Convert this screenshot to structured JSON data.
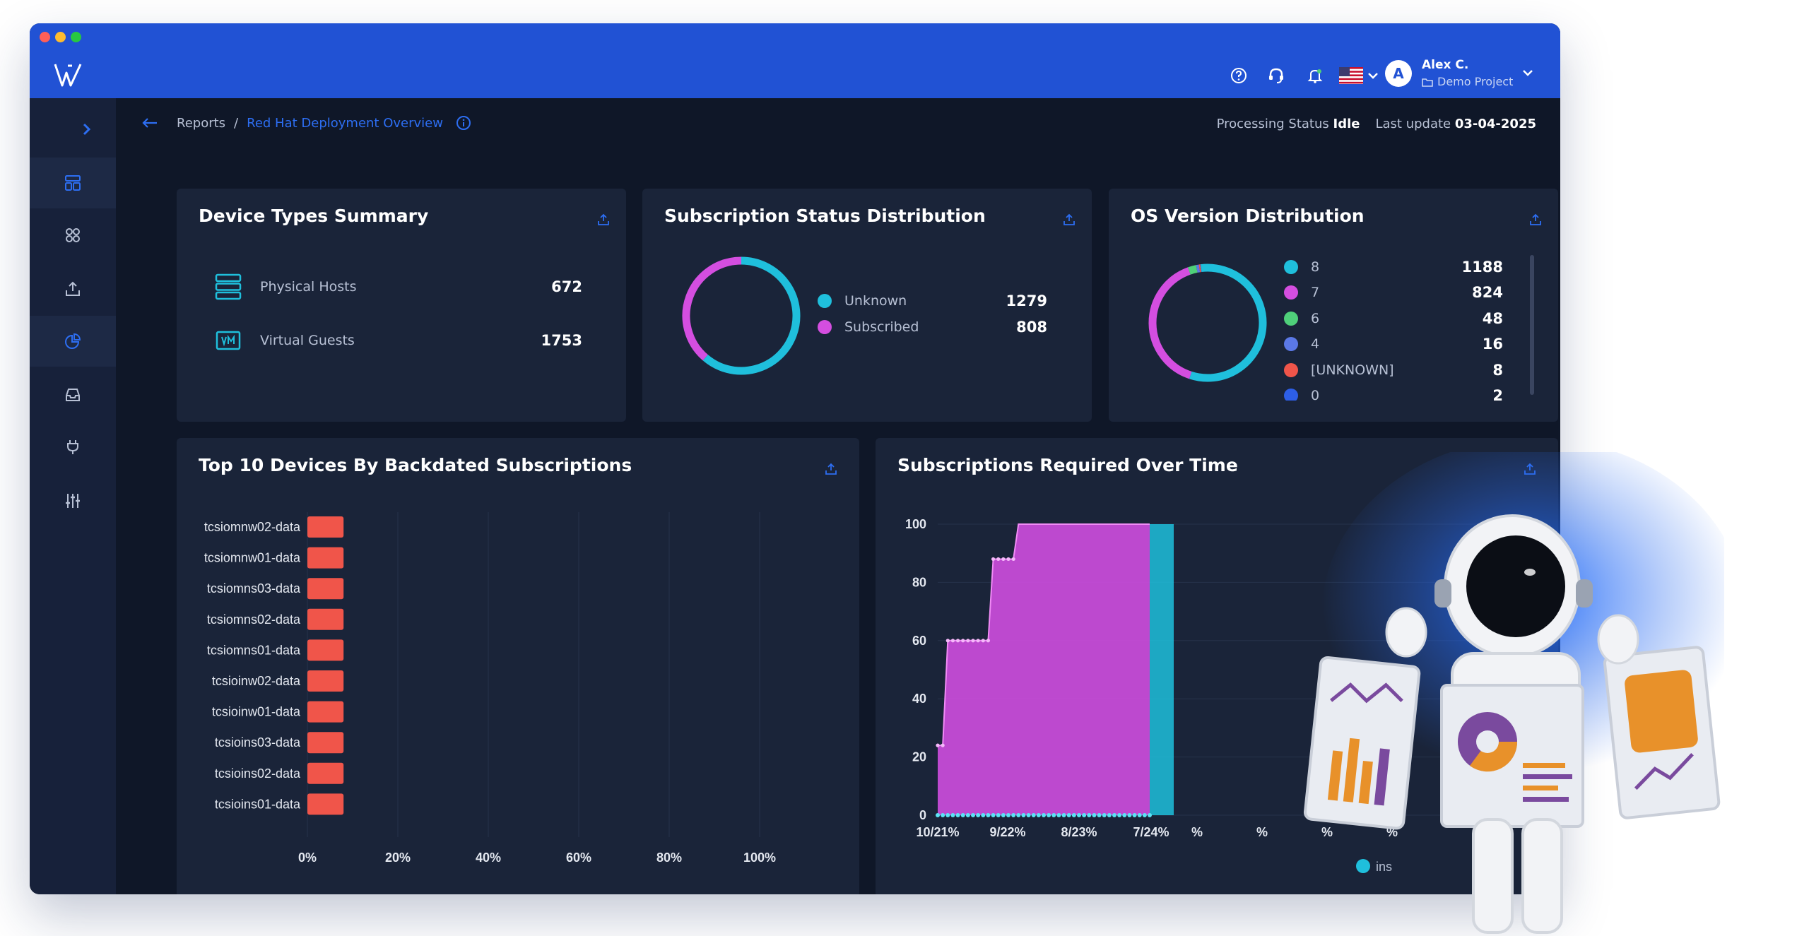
{
  "window": {
    "colors": {
      "header": "#2152d4",
      "sidebar": "#17213a",
      "background": "#0f1728",
      "card": "#1a2439",
      "accent": "#2d6ef2"
    }
  },
  "header": {
    "icons": [
      "help-icon",
      "support-icon",
      "bell-icon",
      "us-flag-icon",
      "chevron-down-icon"
    ],
    "user": {
      "initial": "A",
      "name": "Alex C.",
      "project": "Demo Project"
    }
  },
  "sidebar": {
    "toggle_icon": "chevron-right-icon",
    "items": [
      {
        "icon": "dashboard-icon",
        "active": true
      },
      {
        "icon": "grid-icon",
        "active": false
      },
      {
        "icon": "upload-icon",
        "active": false
      },
      {
        "icon": "pie-chart-icon",
        "active": true
      },
      {
        "icon": "inbox-icon",
        "active": false
      },
      {
        "icon": "plug-icon",
        "active": false
      },
      {
        "icon": "sliders-icon",
        "active": false
      }
    ]
  },
  "breadcrumb": {
    "back_icon": "arrow-left-icon",
    "root": "Reports",
    "separator": "/",
    "current": "Red Hat Deployment Overview"
  },
  "status": {
    "processing_label": "Processing Status",
    "processing_value": "Idle",
    "update_label": "Last update",
    "update_value": "03-04-2025"
  },
  "cards": {
    "device_types": {
      "title": "Device Types Summary",
      "rows": [
        {
          "icon": "server-icon",
          "label": "Physical Hosts",
          "value": "672"
        },
        {
          "icon": "vm-icon",
          "label": "Virtual Guests",
          "value": "1753"
        }
      ]
    },
    "subscription_status": {
      "title": "Subscription Status Distribution",
      "legend": [
        {
          "label": "Unknown",
          "value": "1279",
          "color": "#1fbfdc"
        },
        {
          "label": "Subscribed",
          "value": "808",
          "color": "#d44ee0"
        }
      ]
    },
    "os_version": {
      "title": "OS Version Distribution",
      "legend": [
        {
          "label": "8",
          "value": "1188",
          "color": "#1fbfdc"
        },
        {
          "label": "7",
          "value": "824",
          "color": "#d44ee0"
        },
        {
          "label": "6",
          "value": "48",
          "color": "#4fd07a"
        },
        {
          "label": "4",
          "value": "16",
          "color": "#5b78e6"
        },
        {
          "label": "[UNKNOWN]",
          "value": "8",
          "color": "#f0554a"
        },
        {
          "label": "0",
          "value": "2",
          "color": "#2d5ee6"
        }
      ]
    },
    "top_devices": {
      "title": "Top 10 Devices By Backdated Subscriptions"
    },
    "subscriptions_time": {
      "title": "Subscriptions Required Over Time"
    }
  },
  "chart_data": [
    {
      "type": "pie",
      "title": "Subscription Status Distribution",
      "categories": [
        "Unknown",
        "Subscribed"
      ],
      "values": [
        1279,
        808
      ]
    },
    {
      "type": "pie",
      "title": "OS Version Distribution",
      "categories": [
        "8",
        "7",
        "6",
        "4",
        "[UNKNOWN]",
        "0"
      ],
      "values": [
        1188,
        824,
        48,
        16,
        8,
        2
      ]
    },
    {
      "type": "bar",
      "title": "Top 10 Devices By Backdated Subscriptions",
      "orientation": "horizontal",
      "categories": [
        "tcsiomnw02-data",
        "tcsiomnw01-data",
        "tcsiomns03-data",
        "tcsiomns02-data",
        "tcsiomns01-data",
        "tcsioinw02-data",
        "tcsioinw01-data",
        "tcsioins03-data",
        "tcsioins02-data",
        "tcsioins01-data"
      ],
      "values": [
        8,
        8,
        8,
        8,
        8,
        8,
        8,
        8,
        8,
        8
      ],
      "xticks": [
        "0%",
        "20%",
        "40%",
        "60%",
        "80%",
        "100%"
      ],
      "xlim": [
        0,
        100
      ],
      "color": "#f0554a"
    },
    {
      "type": "area",
      "title": "Subscriptions Required Over Time",
      "x": [
        "10/21%",
        "9/22%",
        "8/23%",
        "7/24%"
      ],
      "extra_ticks": [
        "%",
        "%",
        "%",
        "%"
      ],
      "yticks": [
        0,
        20,
        40,
        60,
        80,
        100
      ],
      "ylim": [
        0,
        100
      ],
      "series": [
        {
          "color": "#cf4ee0",
          "values": [
            24,
            24,
            60,
            60,
            60,
            60,
            60,
            60,
            60,
            60,
            60,
            88,
            88,
            88,
            88,
            88,
            100,
            100,
            100,
            100,
            100,
            100,
            100,
            100,
            100,
            100,
            100,
            100,
            100,
            100,
            100,
            100,
            100,
            100,
            100,
            100,
            100,
            100,
            100,
            100,
            100,
            100,
            100
          ]
        },
        {
          "color": "#1fbfdc",
          "values": [
            0,
            0,
            0,
            0,
            0,
            0,
            0,
            0,
            0,
            0,
            0,
            0,
            0,
            0,
            0,
            0,
            0,
            0,
            0,
            0,
            0,
            0,
            0,
            0,
            0,
            0,
            0,
            0,
            0,
            0,
            0,
            0,
            0,
            0,
            0,
            0,
            0,
            0,
            0,
            0,
            0,
            0,
            0
          ]
        }
      ],
      "legend_fragment": "ins"
    }
  ]
}
